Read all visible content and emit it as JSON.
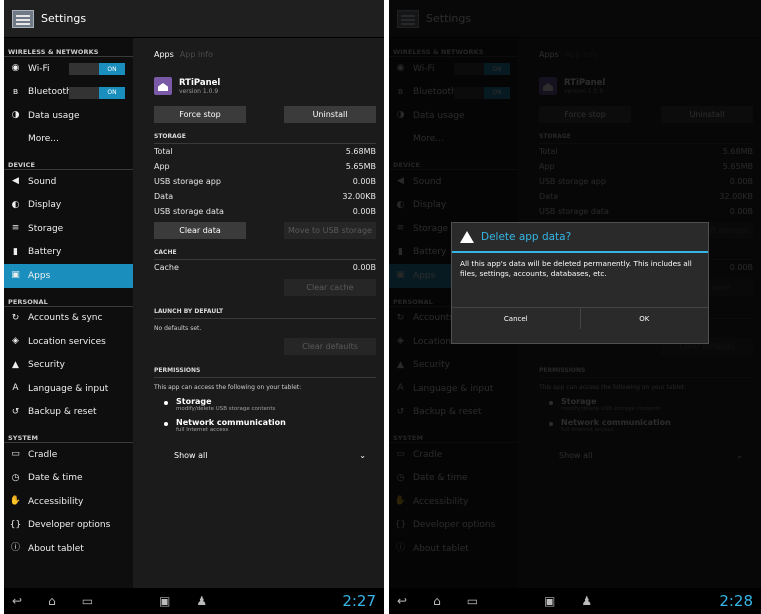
{
  "left": {
    "title": "Settings",
    "sidebar": {
      "sections": [
        {
          "label": "WIRELESS & NETWORKS",
          "items": [
            {
              "icon": "wifi-icon",
              "label": "Wi-Fi",
              "toggle": "ON"
            },
            {
              "icon": "bluetooth-icon",
              "label": "Bluetooth",
              "toggle": "ON"
            },
            {
              "icon": "data-usage-icon",
              "label": "Data usage"
            },
            {
              "icon": "",
              "label": "More..."
            }
          ]
        },
        {
          "label": "DEVICE",
          "items": [
            {
              "icon": "sound-icon",
              "label": "Sound"
            },
            {
              "icon": "display-icon",
              "label": "Display"
            },
            {
              "icon": "storage-icon",
              "label": "Storage"
            },
            {
              "icon": "battery-icon",
              "label": "Battery"
            },
            {
              "icon": "apps-icon",
              "label": "Apps",
              "selected": true
            }
          ]
        },
        {
          "label": "PERSONAL",
          "items": [
            {
              "icon": "sync-icon",
              "label": "Accounts & sync"
            },
            {
              "icon": "location-icon",
              "label": "Location services"
            },
            {
              "icon": "lock-icon",
              "label": "Security"
            },
            {
              "icon": "language-icon",
              "label": "Language & input"
            },
            {
              "icon": "backup-icon",
              "label": "Backup & reset"
            }
          ]
        },
        {
          "label": "SYSTEM",
          "items": [
            {
              "icon": "cradle-icon",
              "label": "Cradle"
            },
            {
              "icon": "clock-icon",
              "label": "Date & time"
            },
            {
              "icon": "accessibility-icon",
              "label": "Accessibility"
            },
            {
              "icon": "braces-icon",
              "label": "Developer options"
            },
            {
              "icon": "info-icon",
              "label": "About tablet"
            }
          ]
        }
      ]
    },
    "content": {
      "crumb_active": "Apps",
      "crumb_dim": "App info",
      "app_name": "RTiPanel",
      "app_version": "version 1.0.9",
      "force_stop": "Force stop",
      "uninstall": "Uninstall",
      "storage_header": "STORAGE",
      "storage": [
        {
          "label": "Total",
          "value": "5.68MB"
        },
        {
          "label": "App",
          "value": "5.65MB"
        },
        {
          "label": "USB storage app",
          "value": "0.00B"
        },
        {
          "label": "Data",
          "value": "32.00KB"
        },
        {
          "label": "USB storage data",
          "value": "0.00B"
        }
      ],
      "clear_data": "Clear data",
      "move_usb": "Move to USB storage",
      "cache_header": "CACHE",
      "cache_label": "Cache",
      "cache_value": "0.00B",
      "clear_cache": "Clear cache",
      "launch_header": "LAUNCH BY DEFAULT",
      "no_defaults": "No defaults set.",
      "clear_defaults": "Clear defaults",
      "perm_header": "PERMISSIONS",
      "perm_intro": "This app can access the following on your tablet:",
      "perms": [
        {
          "title": "Storage",
          "sub": "modify/delete USB storage contents"
        },
        {
          "title": "Network communication",
          "sub": "full Internet access"
        }
      ],
      "show_all": "Show all"
    },
    "clock": "2:27"
  },
  "right": {
    "clock": "2:28",
    "dialog": {
      "title": "Delete app data?",
      "message": "All this app's data will be deleted permanently. This includes all files, settings, accounts, databases, etc.",
      "cancel": "Cancel",
      "ok": "OK"
    }
  }
}
